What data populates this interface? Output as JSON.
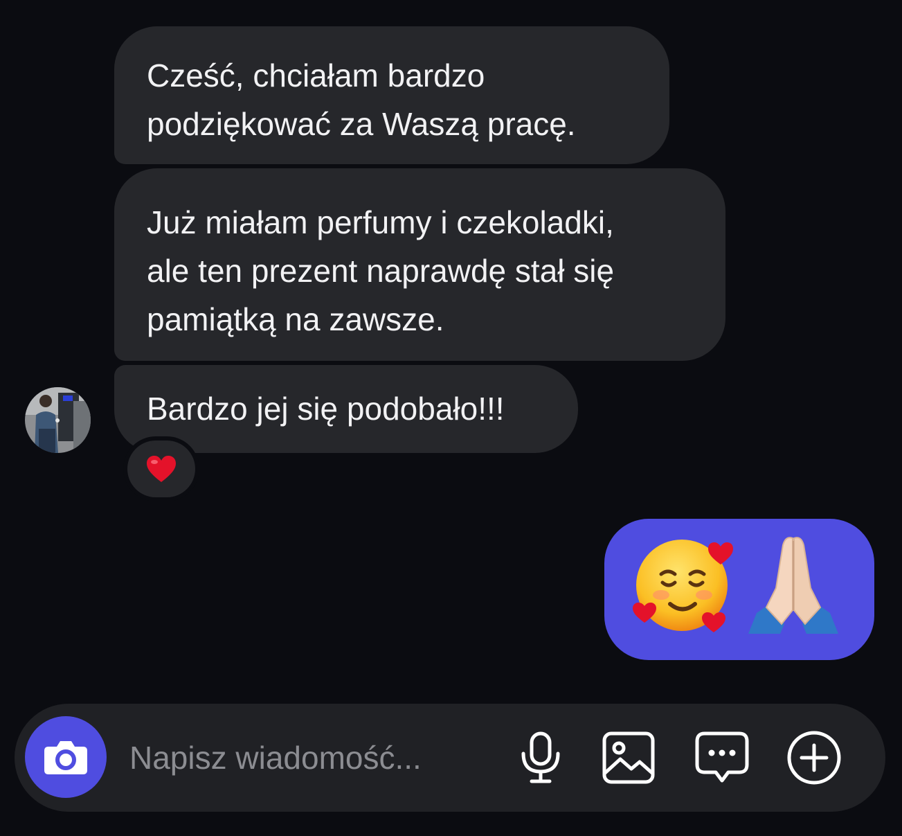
{
  "messages": [
    {
      "text": "Cześć, chciałam bardzo\npodziękować za Waszą pracę."
    },
    {
      "text": "Już miałam perfumy i czekoladki,\nale ten prezent naprawdę stał się\npamiątką na zawsze."
    },
    {
      "text": "Bardzo jej się podobało!!!",
      "reaction": "heart-emoji"
    }
  ],
  "outgoing": {
    "emojis": [
      "smiling-face-with-hearts-emoji",
      "folded-hands-emoji"
    ]
  },
  "composer": {
    "placeholder": "Napisz wiadomość...",
    "icons": [
      "camera-icon",
      "microphone-icon",
      "image-icon",
      "chat-icon",
      "add-icon"
    ]
  },
  "colors": {
    "background": "#0b0c11",
    "incoming_bubble": "#26272b",
    "outgoing_bubble": "#4f4de0",
    "composer": "#202125",
    "accent": "#4f4de0"
  }
}
